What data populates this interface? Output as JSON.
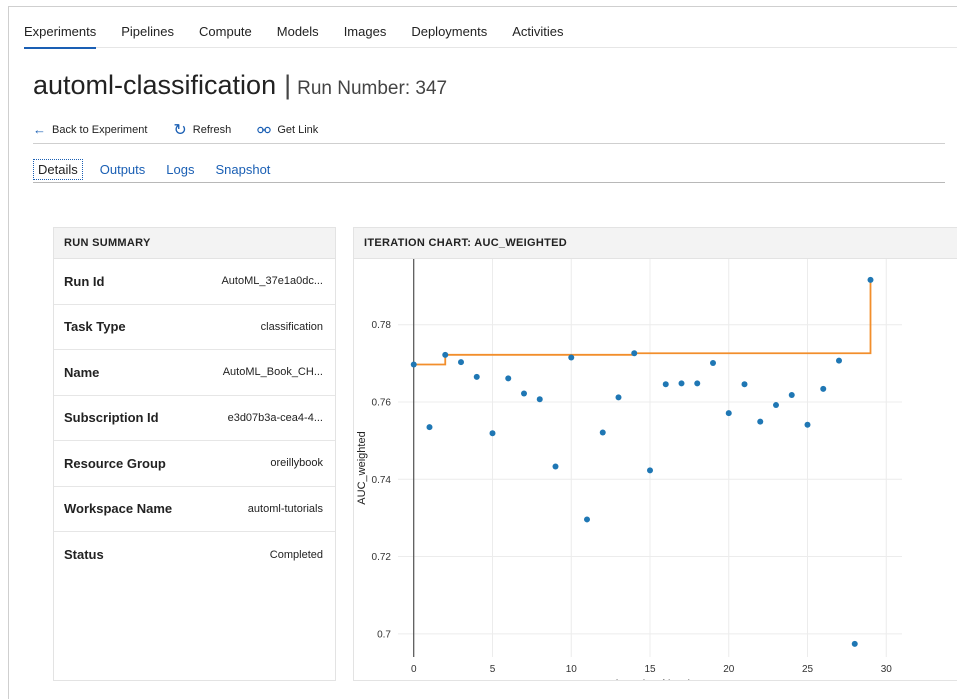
{
  "nav": {
    "items": [
      "Experiments",
      "Pipelines",
      "Compute",
      "Models",
      "Images",
      "Deployments",
      "Activities"
    ],
    "active": "Experiments"
  },
  "header": {
    "title": "automl-classification",
    "separator": "|",
    "run_label": "Run Number: 347"
  },
  "actions": {
    "back": "Back to Experiment",
    "refresh": "Refresh",
    "get_link": "Get Link"
  },
  "subtabs": {
    "items": [
      "Details",
      "Outputs",
      "Logs",
      "Snapshot"
    ],
    "active": "Details"
  },
  "run_summary": {
    "heading": "RUN SUMMARY",
    "rows": [
      {
        "label": "Run Id",
        "value": "AutoML_37e1a0dc..."
      },
      {
        "label": "Task Type",
        "value": "classification"
      },
      {
        "label": "Name",
        "value": "AutoML_Book_CH..."
      },
      {
        "label": "Subscription Id",
        "value": "e3d07b3a-cea4-4..."
      },
      {
        "label": "Resource Group",
        "value": "oreillybook"
      },
      {
        "label": "Workspace Name",
        "value": "automl-tutorials"
      },
      {
        "label": "Status",
        "value": "Completed"
      }
    ]
  },
  "iteration_chart": {
    "heading": "ITERATION CHART: AUC_WEIGHTED"
  },
  "chart_data": {
    "type": "scatter",
    "title": "ITERATION CHART: AUC_WEIGHTED",
    "xlabel": "Iteration Number",
    "ylabel": "AUC_weighted",
    "xlim": [
      -1,
      31
    ],
    "ylim": [
      0.694,
      0.797
    ],
    "xticks": [
      0,
      5,
      10,
      15,
      20,
      25,
      30
    ],
    "yticks": [
      0.7,
      0.72,
      0.74,
      0.76,
      0.78
    ],
    "ytick_labels": [
      "0.7",
      "0.72",
      "0.74",
      "0.76",
      "0.78"
    ],
    "grid": true,
    "series": [
      {
        "type": "scatter",
        "color": "#1f77b4",
        "x": [
          0,
          1,
          2,
          3,
          4,
          5,
          6,
          7,
          8,
          9,
          10,
          11,
          12,
          13,
          14,
          15,
          16,
          17,
          18,
          19,
          20,
          21,
          22,
          23,
          24,
          25,
          26,
          27,
          28,
          29
        ],
        "values": [
          0.7697,
          0.7535,
          0.7722,
          0.7703,
          0.7665,
          0.7519,
          0.7661,
          0.7622,
          0.7607,
          0.7433,
          0.7715,
          0.7296,
          0.7521,
          0.7612,
          0.7726,
          0.7423,
          0.7646,
          0.7648,
          0.7648,
          0.7701,
          0.7571,
          0.7646,
          0.7549,
          0.7592,
          0.7618,
          0.7541,
          0.7634,
          0.7707,
          0.6974,
          0.7916
        ]
      },
      {
        "type": "step",
        "color": "#f28e2b",
        "x": [
          0,
          1,
          2,
          3,
          4,
          5,
          6,
          7,
          8,
          9,
          10,
          11,
          12,
          13,
          14,
          15,
          16,
          17,
          18,
          19,
          20,
          21,
          22,
          23,
          24,
          25,
          26,
          27,
          28,
          29
        ],
        "values": [
          0.7697,
          0.7697,
          0.7722,
          0.7722,
          0.7722,
          0.7722,
          0.7722,
          0.7722,
          0.7722,
          0.7722,
          0.7722,
          0.7722,
          0.7722,
          0.7722,
          0.7726,
          0.7726,
          0.7726,
          0.7726,
          0.7726,
          0.7726,
          0.7726,
          0.7726,
          0.7726,
          0.7726,
          0.7726,
          0.7726,
          0.7726,
          0.7726,
          0.7726,
          0.7916
        ]
      }
    ]
  }
}
